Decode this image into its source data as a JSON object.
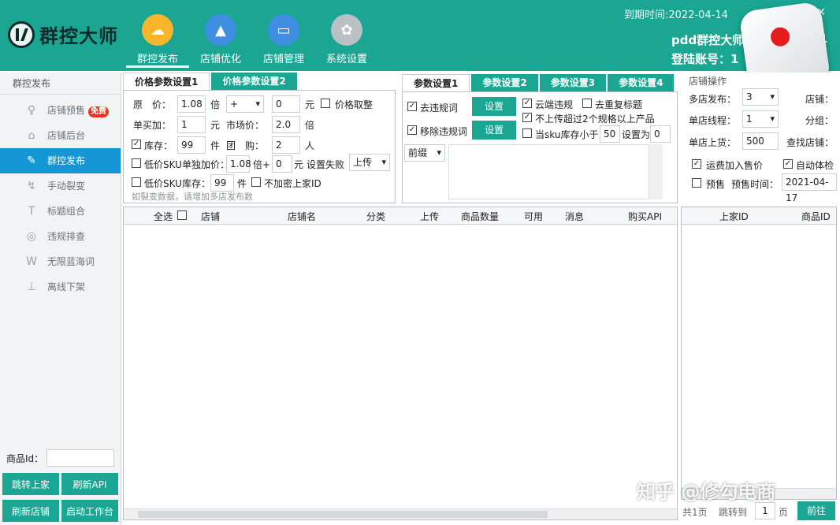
{
  "header": {
    "app_name": "群控大师",
    "nav": [
      {
        "label": "群控发布"
      },
      {
        "label": "店铺优化"
      },
      {
        "label": "店铺管理"
      },
      {
        "label": "系统设置"
      }
    ],
    "expire_text": "到期时间:2022-04-14",
    "account_name": "pdd群控大师",
    "account_suffix": "1",
    "login_label": "登陆账号：",
    "login_value": "1"
  },
  "sidebar": {
    "title": "群控发布",
    "items": [
      {
        "label": "店铺预售",
        "icon": "bulb-icon",
        "badge": "免费"
      },
      {
        "label": "店铺后台",
        "icon": "store-icon"
      },
      {
        "label": "群控发布",
        "icon": "publish-icon"
      },
      {
        "label": "手动裂变",
        "icon": "fission-icon"
      },
      {
        "label": "标题组合",
        "icon": "title-icon"
      },
      {
        "label": "违规排查",
        "icon": "search-icon"
      },
      {
        "label": "无限蓝海词",
        "icon": "words-icon"
      },
      {
        "label": "离线下架",
        "icon": "offline-icon"
      }
    ],
    "product_id_label": "商品Id：",
    "product_id_value": "",
    "buttons": {
      "jump": "跳转上家",
      "refresh_api": "刷新API",
      "refresh_store": "刷新店铺",
      "start_workbench": "启动工作台"
    }
  },
  "price_panel": {
    "tabs": [
      "价格参数设置1",
      "价格参数设置2"
    ],
    "price_label": "原　价：",
    "price_value": "1.08",
    "times": "倍",
    "op_value": "+",
    "add_value": "0",
    "yuan": "元",
    "round_label": "价格取整",
    "single_add_label": "单买加：",
    "single_add_value": "1",
    "market_label": "市场价：",
    "market_value": "2.0",
    "stock_label": "库存：",
    "stock_value": "99",
    "jian": "件",
    "group_label": "团　购：",
    "group_value": "2",
    "ren": "人",
    "low_sku_label": "低价SKU单独加价：",
    "low_sku_times": "1.08",
    "times_plus": "倍+",
    "low_sku_add": "0",
    "fail_label": "设置失败",
    "fail_value": "上传",
    "low_stock_label": "低价SKU库存：",
    "low_stock_value": "99",
    "no_encrypt_label": "不加密上家ID",
    "hint": "如裂变数据，请增加多店发布数"
  },
  "param_panel": {
    "tabs": [
      "参数设置1",
      "参数设置2",
      "参数设置3",
      "参数设置4"
    ],
    "remove_violation": "去违规词",
    "remove_violation_btn": "设置",
    "remove_violation2": "移除违规词",
    "remove_violation2_btn": "设置",
    "cloud_violation": "云端违规",
    "dedupe_title": "去重复标题",
    "no_upload_over": "不上传超过2个规格以上产品",
    "sku_stock_label": "当sku库存小于",
    "sku_stock_value": "50",
    "set_to_label": "设置为",
    "set_to_value": "0",
    "prefix_value": "前缀"
  },
  "store_panel": {
    "title": "店铺操作",
    "multi_label": "多店发布：",
    "multi_value": "3",
    "store_label": "店铺：",
    "thread_label": "单店线程：",
    "thread_value": "1",
    "group_label": "分组：",
    "upload_label": "单店上货：",
    "upload_value": "500",
    "find_label": "查找店铺：",
    "shipping_label": "运费加入售价",
    "auto_check_label": "自动体检",
    "presale_label": "预售",
    "presale_time_label": "预售时间：",
    "presale_time_value": "2021-04-17"
  },
  "main_table": {
    "select_all": "全选",
    "columns": [
      "店铺",
      "店铺名",
      "分类",
      "上传",
      "商品数量",
      "可用",
      "消息",
      "购买API"
    ]
  },
  "right_table": {
    "columns": [
      "上家ID",
      "商品ID"
    ],
    "total": "共1页",
    "jump_to": "跳转到",
    "page_value": "1",
    "page_unit": "页",
    "go_btn": "前往"
  },
  "watermark": "知乎 @修勾电商",
  "colors": {
    "teal": "#1aa692",
    "sidebar_active": "#1597d6",
    "badge_red": "#e8321e"
  }
}
